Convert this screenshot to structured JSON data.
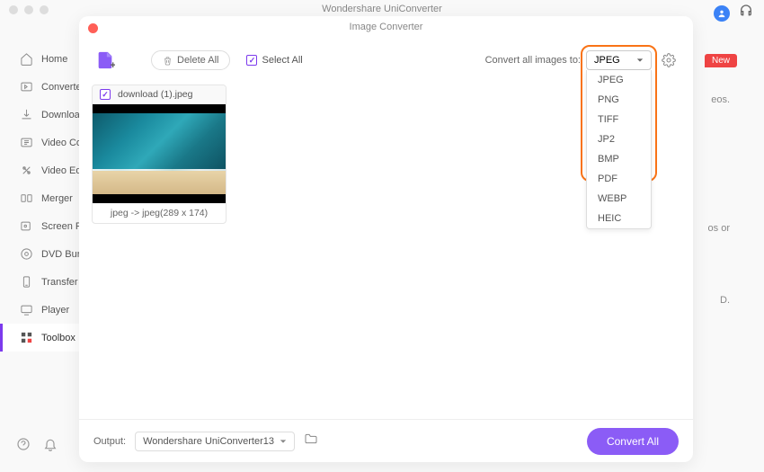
{
  "app": {
    "title": "Wondershare UniConverter"
  },
  "sidebar": {
    "items": [
      {
        "label": "Home"
      },
      {
        "label": "Converter"
      },
      {
        "label": "Downloader"
      },
      {
        "label": "Video Compressor"
      },
      {
        "label": "Video Editor"
      },
      {
        "label": "Merger"
      },
      {
        "label": "Screen Recorder"
      },
      {
        "label": "DVD Burner"
      },
      {
        "label": "Transfer"
      },
      {
        "label": "Player"
      },
      {
        "label": "Toolbox"
      }
    ]
  },
  "modal": {
    "title": "Image Converter",
    "delete_all": "Delete All",
    "select_all": "Select All",
    "convert_label": "Convert all images to:",
    "selected_format": "JPEG",
    "formats": [
      "JPEG",
      "PNG",
      "TIFF",
      "JP2",
      "BMP",
      "PDF",
      "WEBP",
      "HEIC"
    ]
  },
  "file": {
    "name": "download (1).jpeg",
    "footer": "jpeg -> jpeg(289 x 174)"
  },
  "footer": {
    "output_label": "Output:",
    "output_path": "Wondershare UniConverter13",
    "convert_btn": "Convert All"
  },
  "bg": {
    "new_badge": "New",
    "frag1": "eos.",
    "frag2": "os or",
    "frag3": "D."
  }
}
